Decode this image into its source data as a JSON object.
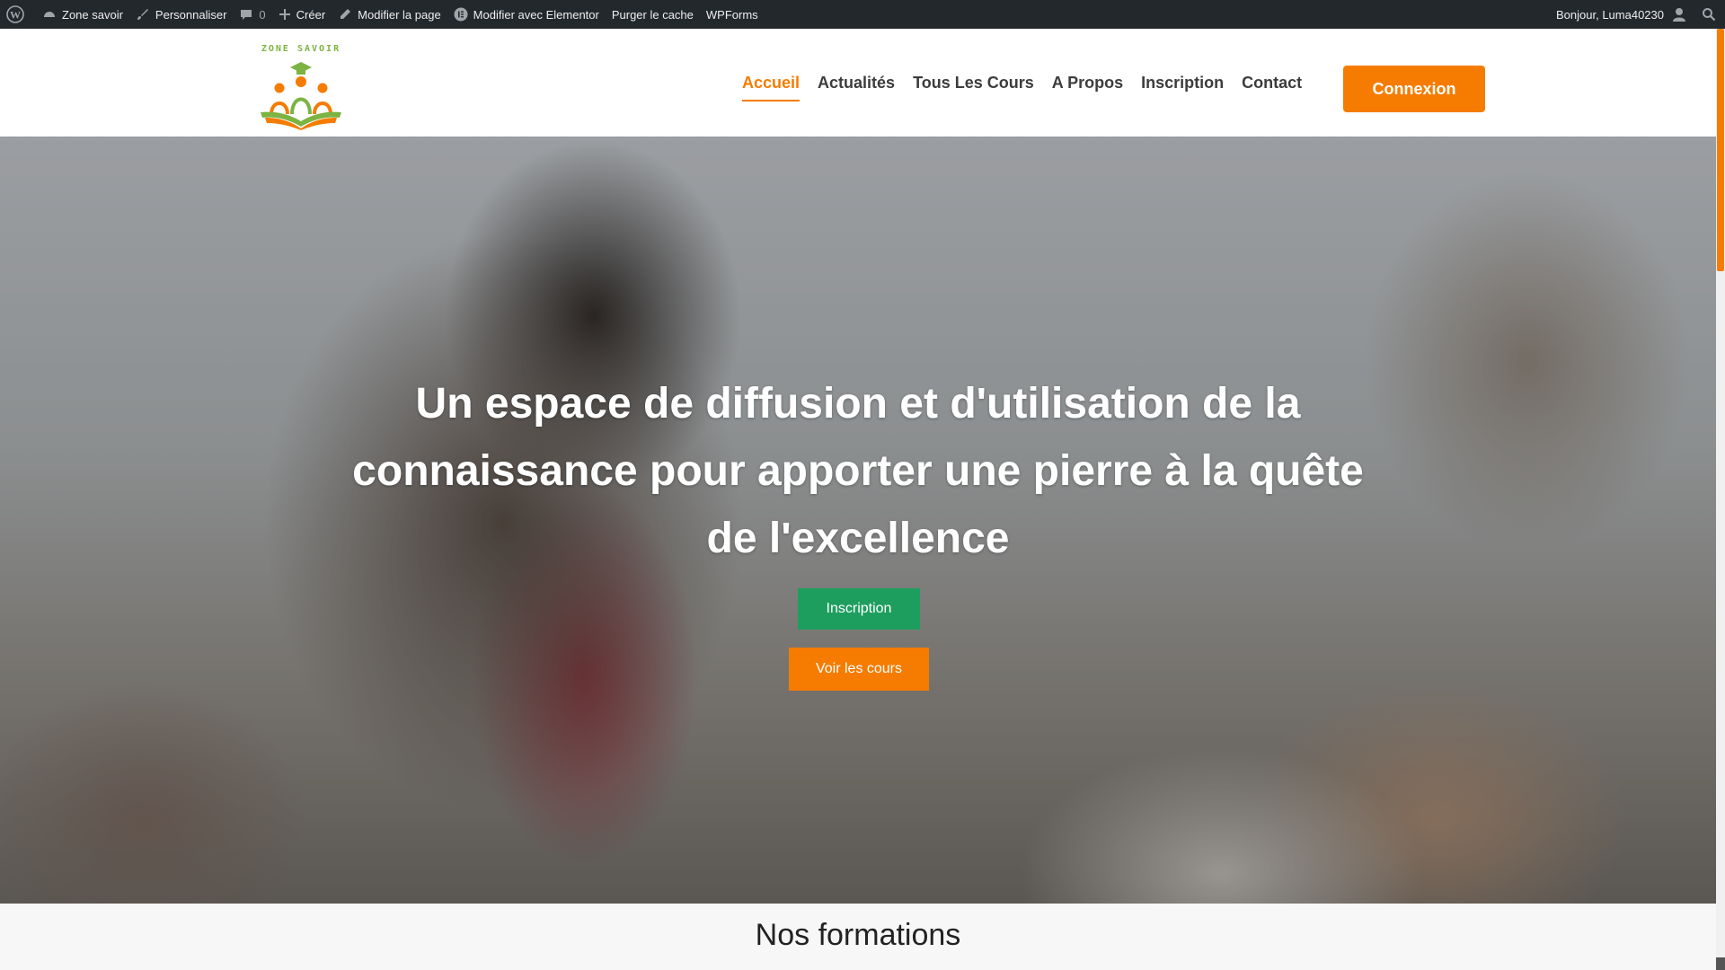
{
  "admin_bar": {
    "items": [
      {
        "icon": "wordpress-logo-icon",
        "label": ""
      },
      {
        "icon": "dashboard-icon",
        "label": "Zone savoir"
      },
      {
        "icon": "brush-icon",
        "label": "Personnaliser"
      },
      {
        "icon": "comment-icon",
        "label": "0"
      },
      {
        "icon": "plus-icon",
        "label": "Créer"
      },
      {
        "icon": "pencil-icon",
        "label": "Modifier la page"
      },
      {
        "icon": "elementor-icon",
        "label": "Modifier avec Elementor"
      },
      {
        "icon": "",
        "label": "Purger le cache"
      },
      {
        "icon": "",
        "label": "WPForms"
      }
    ],
    "greeting": "Bonjour, Luma40230",
    "user_icon": "user-avatar-icon",
    "search_icon": "search-icon"
  },
  "header": {
    "logo_text": "ZONE SAVOIR",
    "nav": [
      {
        "label": "Accueil",
        "active": true
      },
      {
        "label": "Actualités",
        "active": false
      },
      {
        "label": "Tous Les Cours",
        "active": false
      },
      {
        "label": "A Propos",
        "active": false
      },
      {
        "label": "Inscription",
        "active": false
      },
      {
        "label": "Contact",
        "active": false
      }
    ],
    "login_button": "Connexion"
  },
  "hero": {
    "title": "Un espace de diffusion et d'utilisation de la connaissance pour apporter une pierre à la quête de l'excellence",
    "primary_button": "Inscription",
    "secondary_button": "Voir les cours"
  },
  "section": {
    "title": "Nos formations"
  },
  "colors": {
    "accent": "#f57c00",
    "green": "#1e9e5e",
    "admin_bar": "#23282d"
  }
}
